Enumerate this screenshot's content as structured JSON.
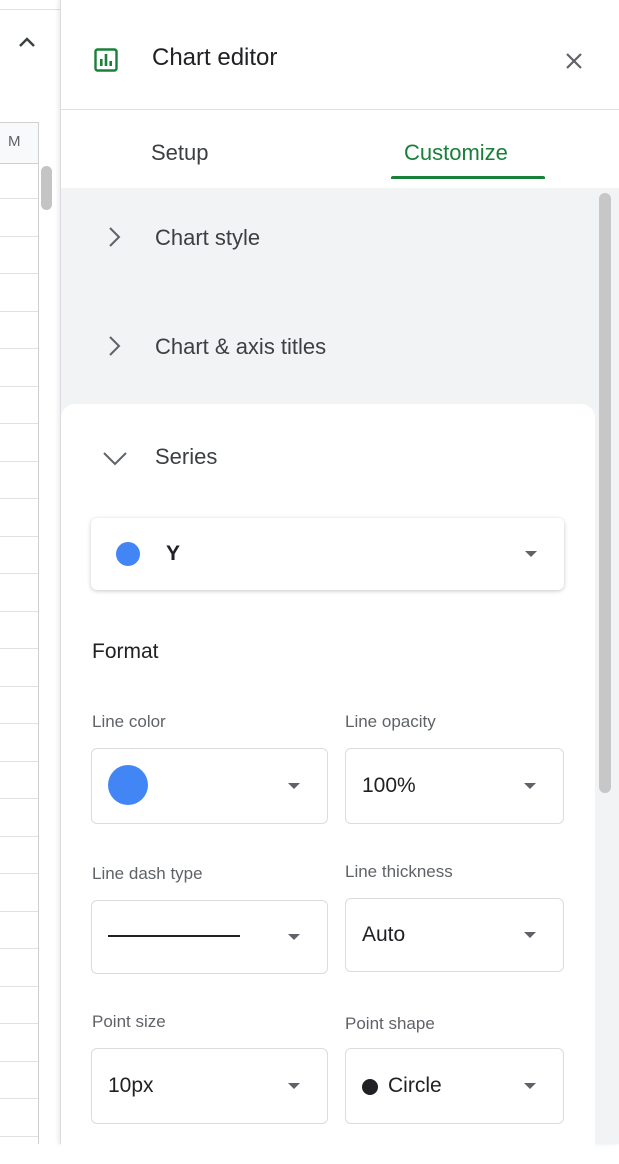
{
  "sheet": {
    "column_header": "M"
  },
  "editor": {
    "title": "Chart editor",
    "tabs": [
      {
        "label": "Setup"
      },
      {
        "label": "Customize"
      }
    ],
    "sections": [
      {
        "label": "Chart style",
        "expanded": false
      },
      {
        "label": "Chart & axis titles",
        "expanded": false
      },
      {
        "label": "Series",
        "expanded": true
      }
    ]
  },
  "series": {
    "selected": "Y",
    "color": "#4285f4"
  },
  "format": {
    "heading": "Format",
    "line_color_label": "Line color",
    "line_color_value": "#4285f4",
    "line_opacity_label": "Line opacity",
    "line_opacity_value": "100%",
    "line_dash_label": "Line dash type",
    "line_dash_value": "solid",
    "line_thickness_label": "Line thickness",
    "line_thickness_value": "Auto",
    "point_size_label": "Point size",
    "point_size_value": "10px",
    "point_shape_label": "Point shape",
    "point_shape_value": "Circle"
  },
  "colors": {
    "accent": "#188038",
    "series_blue": "#4285f4"
  },
  "icons": {
    "collapse": "chevron-up-icon",
    "editor": "chart-editor-icon",
    "close": "close-icon",
    "collapsed_section": "chevron-right-icon",
    "expanded_section": "chevron-down-icon",
    "dropdown": "caret-down-icon"
  }
}
